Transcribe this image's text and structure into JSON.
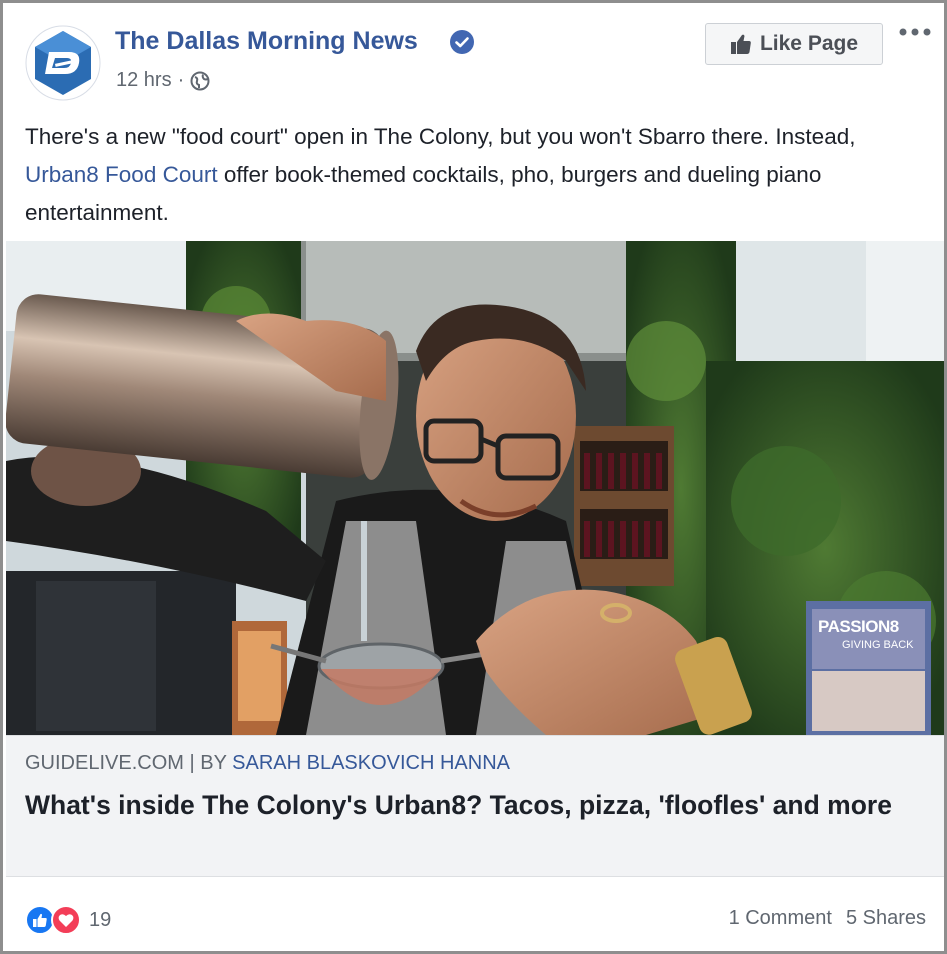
{
  "post": {
    "page_name": "The Dallas Morning News",
    "timestamp": "12 hrs",
    "separator": "·",
    "privacy_icon": "globe-icon",
    "like_button_label": "Like Page",
    "message_part1": "There's a new \"food court\" open in The Colony, but you won't Sbarro there. Instead, ",
    "message_link": "Urban8 Food Court",
    "message_part2": " offer book-themed cocktails, pho, burgers and dueling piano entertainment."
  },
  "photo": {
    "sign_title": "PASSION8",
    "sign_subtitle": "GIVING BACK"
  },
  "link": {
    "source": "GUIDELIVE.COM",
    "separator": "|",
    "by": "BY",
    "author": "SARAH BLASKOVICH HANNA",
    "title": "What's inside The Colony's Urban8? Tacos, pizza, 'floofles' and more"
  },
  "footer": {
    "reaction_count": "19",
    "comments": "1 Comment",
    "shares": "5 Shares"
  },
  "colors": {
    "link_blue": "#365899",
    "like_blue": "#1877f2",
    "love_red": "#f33e58"
  }
}
